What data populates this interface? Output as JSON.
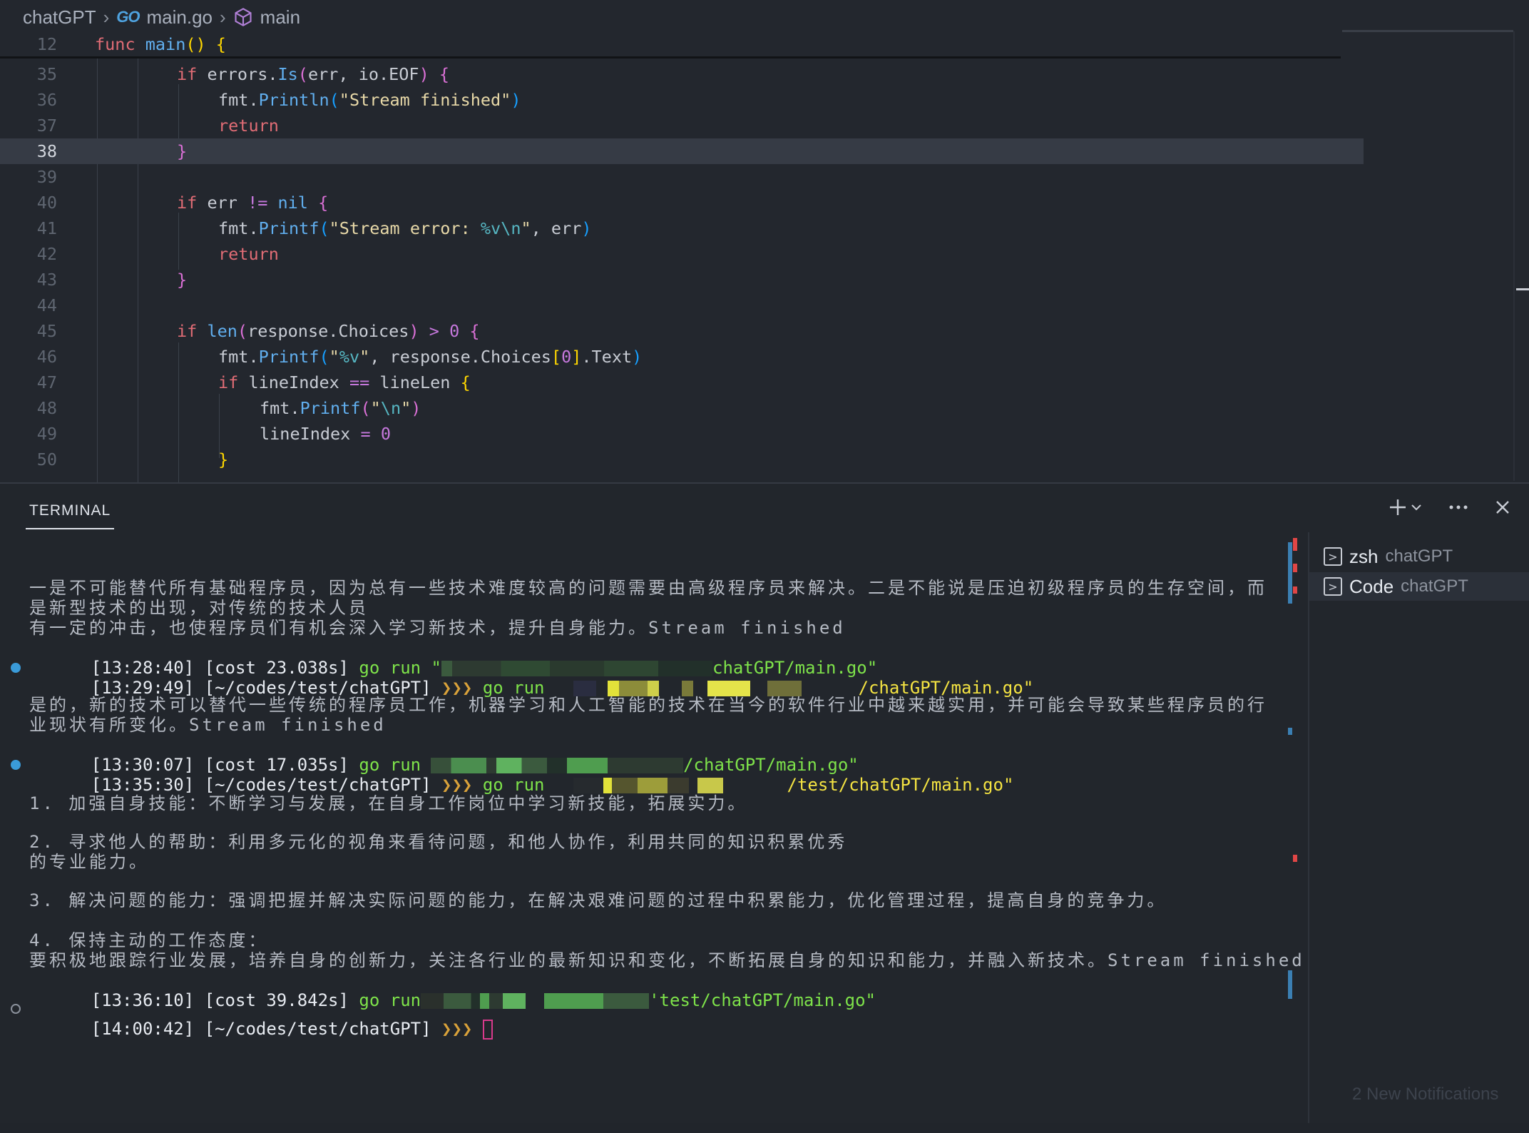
{
  "breadcrumb": {
    "folder": "chatGPT",
    "go_icon": "GO",
    "file": "main.go",
    "symbol": "main"
  },
  "editor": {
    "sticky": {
      "ln": "12",
      "code": "func main() {"
    },
    "lines": [
      {
        "ln": "35",
        "code": "if errors.Is(err, io.EOF) {"
      },
      {
        "ln": "36",
        "code": "fmt.Println(\"Stream finished\")"
      },
      {
        "ln": "37",
        "code": "return"
      },
      {
        "ln": "38",
        "code": "}"
      },
      {
        "ln": "39",
        "code": ""
      },
      {
        "ln": "40",
        "code": "if err != nil {"
      },
      {
        "ln": "41",
        "code": "fmt.Printf(\"Stream error: %v\\n\", err)"
      },
      {
        "ln": "42",
        "code": "return"
      },
      {
        "ln": "43",
        "code": "}"
      },
      {
        "ln": "44",
        "code": ""
      },
      {
        "ln": "45",
        "code": "if len(response.Choices) > 0 {"
      },
      {
        "ln": "46",
        "code": "fmt.Printf(\"%v\", response.Choices[0].Text)"
      },
      {
        "ln": "47",
        "code": "if lineIndex == lineLen {"
      },
      {
        "ln": "48",
        "code": "fmt.Printf(\"\\n\")"
      },
      {
        "ln": "49",
        "code": "lineIndex = 0"
      },
      {
        "ln": "50",
        "code": "}"
      }
    ],
    "active_line": "38"
  },
  "panel": {
    "tab": "TERMINAL",
    "actions": [
      "add-icon",
      "chevron-down-icon",
      "more-icon",
      "close-icon"
    ]
  },
  "terminal": {
    "block1": {
      "line1": "一是不可能替代所有基础程序员，因为总有一些技术难度较高的问题需要由高级程序员来解决。二是不能说是压迫初级程序员的生存空间，而",
      "line2": "是新型技术的出现，对传统的技术人员",
      "line3": "有一定的冲击，也使程序员们有机会深入学习新技术，提升自身能力。Stream finished",
      "cost_time": "[13:28:40]",
      "cost": "[cost 23.038s]",
      "cmd": "go run \"",
      "path": "chatGPT/main.go\""
    },
    "prompt1": {
      "time": "[13:29:49]",
      "dir": "[~/codes/test/chatGPT]",
      "arrows": "❯❯❯",
      "cmd": "go run",
      "path": "/chatGPT/main.go\""
    },
    "block2": {
      "line1": "是的，新的技术可以替代一些传统的程序员工作，机器学习和人工智能的技术在当今的软件行业中越来越实用，并可能会导致某些程序员的行",
      "line2": "业现状有所变化。Stream finished",
      "cost_time": "[13:30:07]",
      "cost": "[cost 17.035s]",
      "cmd": "go run",
      "path": "/chatGPT/main.go\""
    },
    "prompt2": {
      "time": "[13:35:30]",
      "dir": "[~/codes/test/chatGPT]",
      "arrows": "❯❯❯",
      "cmd": "go run",
      "path": "/test/chatGPT/main.go\""
    },
    "block3": {
      "item1": "1. 加强自身技能：不断学习与发展，在自身工作岗位中学习新技能，拓展实力。",
      "item2a": "2. 寻求他人的帮助：利用多元化的视角来看待问题，和他人协作，利用共同的知识积累优秀",
      "item2b": "的专业能力。",
      "item3": "3. 解决问题的能力：强调把握并解决实际问题的能力，在解决艰难问题的过程中积累能力，优化管理过程，提高自身的竞争力。",
      "item4a": "4. 保持主动的工作态度：",
      "item4b": "要积极地跟踪行业发展，培养自身的创新力，关注各行业的最新知识和变化，不断拓展自身的知识和能力，并融入新技术。Stream finished",
      "cost_time": "[13:36:10]",
      "cost": "[cost 39.842s]",
      "cmd": "go run",
      "path": "'test/chatGPT/main.go\""
    },
    "prompt3": {
      "time": "[14:00:42]",
      "dir": "[~/codes/test/chatGPT]",
      "arrows": "❯❯❯"
    }
  },
  "terminal_list": [
    {
      "name": "zsh",
      "sub": "chatGPT"
    },
    {
      "name": "Code",
      "sub": "chatGPT"
    }
  ],
  "notifications": "2 New Notifications"
}
